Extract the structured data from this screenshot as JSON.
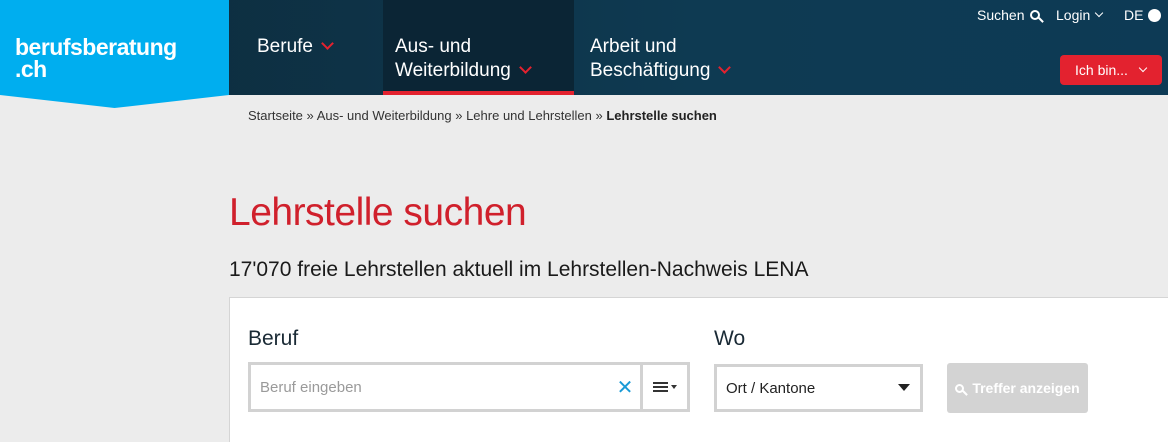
{
  "logo": {
    "line1": "berufsberatung",
    "line2": ".ch"
  },
  "nav": {
    "berufe": "Berufe",
    "aus_line1": "Aus- und",
    "aus_line2": "Weiterbildung",
    "arbeit_line1": "Arbeit und",
    "arbeit_line2": "Beschäftigung"
  },
  "topbar": {
    "suchen": "Suchen",
    "login": "Login",
    "lang": "DE"
  },
  "ichbin": "Ich bin...",
  "breadcrumb": {
    "items": [
      "Startseite",
      "Aus- und Weiterbildung",
      "Lehre und Lehrstellen"
    ],
    "current": "Lehrstelle suchen",
    "separator": "»"
  },
  "page": {
    "title": "Lehrstelle suchen",
    "subtitle": "17'070 freie Lehrstellen aktuell im Lehrstellen-Nachweis LENA"
  },
  "search": {
    "beruf_label": "Beruf",
    "beruf_placeholder": "Beruf eingeben",
    "beruf_value": "",
    "clear_symbol": "✕",
    "wo_label": "Wo",
    "wo_selected": "Ort / Kantone",
    "submit_label": "Treffer anzeigen"
  },
  "colors": {
    "brand_blue": "#00aeef",
    "accent_red": "#e3222f",
    "header_dark": "#0e3a52"
  }
}
